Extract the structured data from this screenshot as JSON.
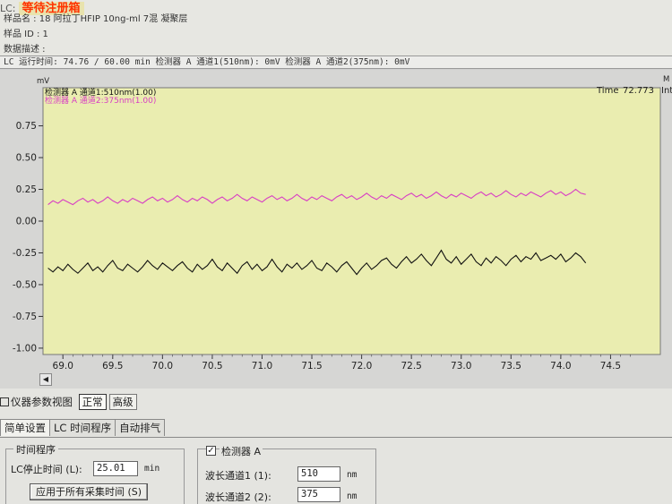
{
  "header": {
    "lc_prefix": "LC:",
    "status": "等待注册箱",
    "sample_name": "样品名 : 18 阿拉丁HFIP 10ng-ml 7混 凝聚层",
    "sample_id": "样品 ID : 1",
    "data_desc": "数据描述 :",
    "run_bar": "LC 运行时间: 74.76 / 60.00 min  检测器 A 通道1(510nm): 0mV  检测器 A 通道2(375nm): 0mV"
  },
  "chart_panel": {
    "y_unit": "mV",
    "time_label": "Time",
    "time_value": "72.773",
    "int_label": "Int",
    "corner_label": "M"
  },
  "colors": {
    "plot_bg": "#eaedb0",
    "series1": "#111111",
    "series2": "#d83ec4"
  },
  "chart_data": {
    "type": "line",
    "xlim": [
      68.8,
      75.0
    ],
    "ylim": [
      -1.05,
      1.05
    ],
    "x_ticks": [
      "69.0",
      "69.5",
      "70.0",
      "70.5",
      "71.0",
      "71.5",
      "72.0",
      "72.5",
      "73.0",
      "73.5",
      "74.0",
      "74.5"
    ],
    "y_ticks": [
      "0.75",
      "0.50",
      "0.25",
      "0.00",
      "-0.25",
      "-0.50",
      "-0.75",
      "-1.00"
    ],
    "x_start": 68.85,
    "x_step": 0.05,
    "series": [
      {
        "name": "检测器 A 通道1:510nm(1.00)",
        "color": "#111111",
        "values": [
          -0.37,
          -0.4,
          -0.36,
          -0.39,
          -0.34,
          -0.38,
          -0.41,
          -0.37,
          -0.33,
          -0.39,
          -0.36,
          -0.4,
          -0.35,
          -0.31,
          -0.37,
          -0.39,
          -0.34,
          -0.37,
          -0.4,
          -0.36,
          -0.31,
          -0.35,
          -0.38,
          -0.33,
          -0.36,
          -0.39,
          -0.35,
          -0.32,
          -0.37,
          -0.4,
          -0.34,
          -0.38,
          -0.35,
          -0.3,
          -0.36,
          -0.39,
          -0.33,
          -0.37,
          -0.41,
          -0.35,
          -0.32,
          -0.38,
          -0.34,
          -0.39,
          -0.36,
          -0.3,
          -0.36,
          -0.4,
          -0.34,
          -0.37,
          -0.33,
          -0.38,
          -0.35,
          -0.31,
          -0.37,
          -0.39,
          -0.33,
          -0.36,
          -0.4,
          -0.35,
          -0.32,
          -0.37,
          -0.42,
          -0.37,
          -0.33,
          -0.38,
          -0.35,
          -0.31,
          -0.29,
          -0.34,
          -0.37,
          -0.32,
          -0.28,
          -0.33,
          -0.3,
          -0.26,
          -0.31,
          -0.35,
          -0.29,
          -0.23,
          -0.3,
          -0.33,
          -0.28,
          -0.34,
          -0.3,
          -0.26,
          -0.32,
          -0.35,
          -0.29,
          -0.33,
          -0.28,
          -0.31,
          -0.35,
          -0.3,
          -0.27,
          -0.32,
          -0.28,
          -0.3,
          -0.25,
          -0.31,
          -0.29,
          -0.27,
          -0.3,
          -0.26,
          -0.32,
          -0.29,
          -0.25,
          -0.28,
          -0.33
        ]
      },
      {
        "name": "检测器 A 通道2:375nm(1.00)",
        "color": "#d83ec4",
        "values": [
          0.13,
          0.16,
          0.14,
          0.17,
          0.15,
          0.13,
          0.16,
          0.18,
          0.15,
          0.17,
          0.14,
          0.16,
          0.19,
          0.16,
          0.14,
          0.17,
          0.15,
          0.18,
          0.16,
          0.14,
          0.17,
          0.19,
          0.16,
          0.18,
          0.15,
          0.17,
          0.2,
          0.17,
          0.15,
          0.18,
          0.16,
          0.19,
          0.17,
          0.14,
          0.17,
          0.19,
          0.16,
          0.18,
          0.21,
          0.18,
          0.16,
          0.19,
          0.17,
          0.15,
          0.18,
          0.2,
          0.17,
          0.19,
          0.16,
          0.18,
          0.21,
          0.18,
          0.16,
          0.19,
          0.17,
          0.2,
          0.18,
          0.16,
          0.19,
          0.21,
          0.18,
          0.2,
          0.17,
          0.19,
          0.22,
          0.19,
          0.17,
          0.2,
          0.18,
          0.21,
          0.19,
          0.17,
          0.2,
          0.22,
          0.19,
          0.21,
          0.18,
          0.2,
          0.23,
          0.2,
          0.18,
          0.21,
          0.19,
          0.22,
          0.2,
          0.18,
          0.21,
          0.23,
          0.2,
          0.22,
          0.19,
          0.21,
          0.24,
          0.21,
          0.19,
          0.22,
          0.2,
          0.23,
          0.21,
          0.19,
          0.22,
          0.24,
          0.21,
          0.23,
          0.2,
          0.22,
          0.25,
          0.22,
          0.21
        ]
      }
    ]
  },
  "view_bar": {
    "label": "仪器参数视图",
    "normal": "正常",
    "advanced": "高级"
  },
  "tabs": [
    "简单设置",
    "LC 时间程序",
    "自动排气"
  ],
  "time_program": {
    "title": "时间程序",
    "stop_label": "LC停止时间 (L):",
    "stop_value": "25.01",
    "stop_unit": "min",
    "apply_button": "应用于所有采集时间 (S)"
  },
  "detector": {
    "checked": "✓",
    "title": "检测器 A",
    "ch1_label": "波长通道1 (1):",
    "ch1_value": "510",
    "ch2_label": "波长通道2 (2):",
    "ch2_value": "375",
    "unit": "nm"
  }
}
